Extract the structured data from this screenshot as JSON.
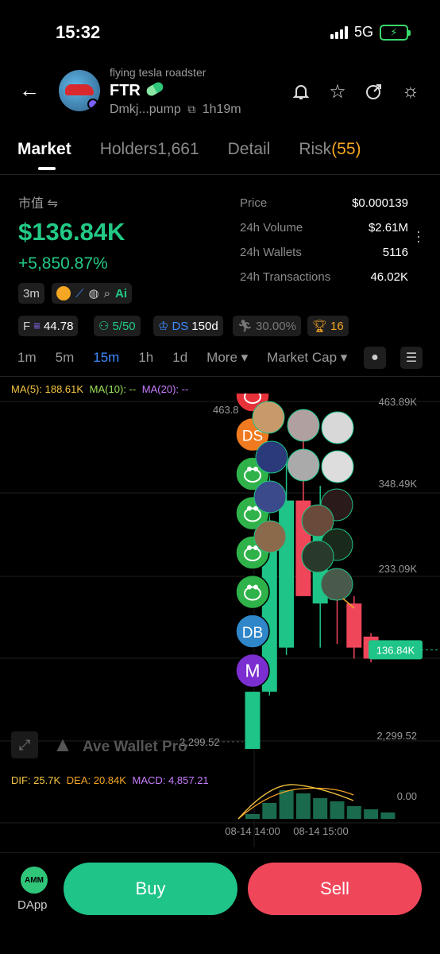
{
  "status": {
    "time": "15:32",
    "network": "5G"
  },
  "token": {
    "subtitle": "flying tesla roadster",
    "name": "FTR",
    "address": "Dmkj...pump",
    "age": "1h19m"
  },
  "tabs": [
    {
      "label": "Market",
      "active": true
    },
    {
      "label": "Holders",
      "count": "1,661"
    },
    {
      "label": "Detail"
    },
    {
      "label": "Risk",
      "count": "(55)"
    }
  ],
  "market_cap": {
    "label": "市值 ⇋",
    "value": "$136.84K",
    "change": "+5,850.87%"
  },
  "stats": [
    {
      "k": "Price",
      "v": "$0.000139"
    },
    {
      "k": "24h Volume",
      "v": "$2.61M"
    },
    {
      "k": "24h Wallets",
      "v": "5116"
    },
    {
      "k": "24h Transactions",
      "v": "46.02K"
    }
  ],
  "chips_row1": {
    "age": "3m",
    "ai": "Ai"
  },
  "chips_row2": {
    "f_label": "F",
    "f_value": "44.78",
    "holders": "5/50",
    "ds_label": "DS",
    "ds_value": "150d",
    "pct": "30.00%",
    "trophy": "16"
  },
  "timeframes": [
    "1m",
    "5m",
    "15m",
    "1h",
    "1d",
    "More ▾",
    "Market Cap ▾"
  ],
  "active_timeframe": "15m",
  "ma": {
    "ma5": "MA(5): 188.61K",
    "ma10": "MA(10): --",
    "ma20": "MA(20): --"
  },
  "macd": {
    "dif": "DIF: 25.7K",
    "dea": "DEA: 20.84K",
    "macd": "MACD: 4,857.21"
  },
  "chart_data": {
    "type": "candlestick",
    "y_ticks": [
      "463.89K",
      "348.49K",
      "233.09K",
      "2,299.52"
    ],
    "current_price_label": "136.84K",
    "high_label": "463.8",
    "low_label": "2,299.52",
    "x_ticks": [
      "08-14 14:00",
      "08-14 15:00"
    ],
    "macd_zero": "0.00",
    "watermark": "Ave Wallet Pro",
    "candles": [
      {
        "o": 2299.52,
        "h": 80000,
        "l": 2299.52,
        "c": 80000,
        "up": true
      },
      {
        "o": 80000,
        "h": 390000,
        "l": 75000,
        "c": 290000,
        "up": true
      },
      {
        "o": 140000,
        "h": 400000,
        "l": 130000,
        "c": 340000,
        "up": true
      },
      {
        "o": 340000,
        "h": 463890,
        "l": 230000,
        "c": 210000,
        "up": false
      },
      {
        "o": 200000,
        "h": 360000,
        "l": 140000,
        "c": 330000,
        "up": true
      },
      {
        "o": 210000,
        "h": 245000,
        "l": 145000,
        "c": 205000,
        "up": false
      },
      {
        "o": 200000,
        "h": 210000,
        "l": 125000,
        "c": 140000,
        "up": false
      },
      {
        "o": 155000,
        "h": 160000,
        "l": 120000,
        "c": 125000,
        "up": false
      },
      {
        "o": 125000,
        "h": 145000,
        "l": 125000,
        "c": 136840,
        "up": true
      }
    ]
  },
  "markers": [
    {
      "type": "frog",
      "color": "#e8323a"
    },
    {
      "type": "text",
      "text": "DS",
      "color": "#f07a20"
    },
    {
      "type": "frog",
      "color": "#2fb24a"
    },
    {
      "type": "frog",
      "color": "#2fb24a"
    },
    {
      "type": "frog",
      "color": "#2fb24a"
    },
    {
      "type": "frog",
      "color": "#2fb24a"
    },
    {
      "type": "text",
      "text": "DB",
      "color": "#2f86c8"
    },
    {
      "type": "text",
      "text": "M",
      "color": "#7b2fd0"
    }
  ],
  "bottom": {
    "dapp": "DApp",
    "buy": "Buy",
    "sell": "Sell",
    "amm": "AMM"
  }
}
